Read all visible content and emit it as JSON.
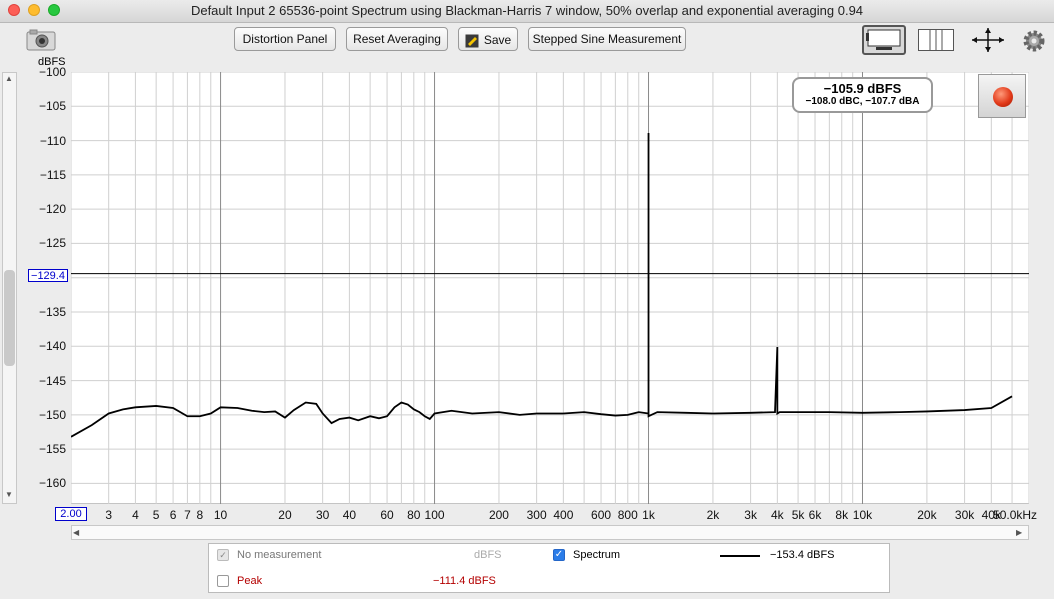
{
  "window": {
    "title": "Default Input 2 65536-point Spectrum using Blackman-Harris 7 window, 50% overlap and exponential averaging 0.94"
  },
  "toolbar": {
    "distortion_label": "Distortion Panel",
    "reset_label": "Reset Averaging",
    "save_label": "Save",
    "stepped_label": "Stepped Sine Measurement"
  },
  "readout": {
    "main": "−105.9 dBFS",
    "sub": "−108.0 dBC, −107.7 dBA"
  },
  "cursor": {
    "value": -129.4,
    "label": "−129.4",
    "x_start_label": "2.00"
  },
  "legend": {
    "no_measurement": "No measurement",
    "no_measurement_unit": "dBFS",
    "spectrum": "Spectrum",
    "spectrum_value": "−153.4 dBFS",
    "peak": "Peak",
    "peak_value": "−111.4 dBFS",
    "spectrum_checked": true,
    "peak_checked": false
  },
  "colors": {
    "trace": "#000000",
    "peak_text": "#b40000",
    "cursor_label": "#0000cc",
    "record": "#e23a1a"
  },
  "chart_data": {
    "type": "line",
    "ylabel": "dBFS",
    "ylim": [
      -163,
      -100
    ],
    "xlim": [
      2,
      60000
    ],
    "xscale": "log",
    "grid": true,
    "y_ticks": [
      -100,
      -105,
      -110,
      -115,
      -120,
      -125,
      -130,
      -135,
      -140,
      -145,
      -150,
      -155,
      -160
    ],
    "y_tick_labels": [
      "−100",
      "−105",
      "−110",
      "−115",
      "−120",
      "−125",
      "",
      "−135",
      "−140",
      "−145",
      "−150",
      "−155",
      "−160"
    ],
    "x_ticks": [
      3,
      4,
      5,
      6,
      7,
      8,
      10,
      20,
      30,
      40,
      60,
      80,
      100,
      200,
      300,
      400,
      600,
      800,
      1000,
      2000,
      3000,
      4000,
      5000,
      6000,
      8000,
      10000,
      20000,
      30000,
      40000,
      50000
    ],
    "x_tick_labels": [
      "3",
      "4",
      "5",
      "6",
      "7",
      "8",
      "10",
      "20",
      "30",
      "40",
      "60",
      "80",
      "100",
      "200",
      "300",
      "400",
      "600",
      "800",
      "1k",
      "2k",
      "3k",
      "4k",
      "5k",
      "6k",
      "8k",
      "10k",
      "20k",
      "30k",
      "40k",
      "50.0kHz"
    ],
    "series": [
      {
        "x": [
          2,
          2.5,
          3,
          3.5,
          4,
          5,
          6,
          7,
          8,
          9,
          10,
          12,
          14,
          16,
          18,
          20,
          22,
          25,
          28,
          30,
          33,
          36,
          40,
          44,
          50,
          55,
          60,
          65,
          70,
          75,
          80,
          85,
          90,
          95,
          100,
          120,
          150,
          200,
          250,
          300,
          400,
          500,
          600,
          700,
          800,
          900,
          1000,
          1000,
          1000,
          1100,
          1500,
          2000,
          3000,
          3900,
          4000,
          4000,
          4100,
          5000,
          7000,
          10000,
          15000,
          20000,
          30000,
          40000,
          50000
        ],
        "y": [
          -153.2,
          -151.5,
          -149.8,
          -149.2,
          -148.9,
          -148.7,
          -149,
          -150.2,
          -150.2,
          -149.8,
          -148.9,
          -149,
          -149.4,
          -149.6,
          -149.5,
          -150.4,
          -149.3,
          -148.2,
          -148.4,
          -149.8,
          -151.2,
          -150.6,
          -150.4,
          -150.8,
          -150.2,
          -150.5,
          -150.2,
          -148.9,
          -148.2,
          -148.5,
          -149.2,
          -149.6,
          -150.2,
          -150.6,
          -149.8,
          -149.4,
          -149.8,
          -149.6,
          -150,
          -149.8,
          -149.8,
          -149.6,
          -149.9,
          -150.1,
          -150,
          -149.6,
          -149.8,
          -108.9,
          -150.2,
          -149.6,
          -149.7,
          -149.8,
          -149.7,
          -149.6,
          -140.1,
          -149.8,
          -149.6,
          -149.6,
          -149.6,
          -149.7,
          -149.6,
          -149.5,
          -149.3,
          -149.0,
          -147.3
        ]
      }
    ]
  }
}
